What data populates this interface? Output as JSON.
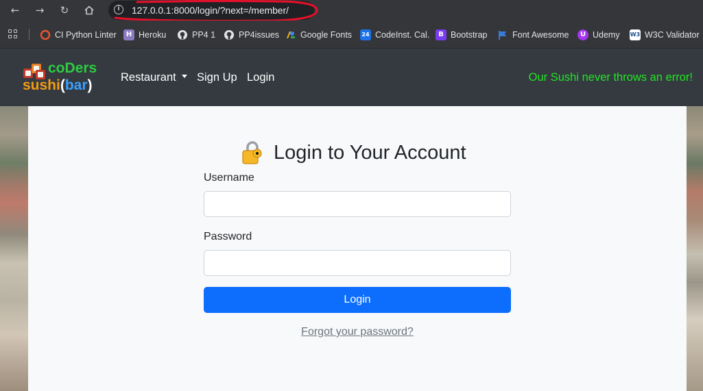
{
  "browser": {
    "url_host": "127.0.0.1",
    "url_rest": ":8000/login/?next=/member/",
    "back_icon": "arrow-left-icon",
    "forward_icon": "arrow-right-icon",
    "reload_icon": "reload-icon",
    "home_icon": "home-icon",
    "site_info_icon": "info-icon",
    "annotation_color": "#e8102a",
    "bookmarks": [
      {
        "label": "CI Python Linter",
        "icon": "ci-linter-icon",
        "color": "#e8542f"
      },
      {
        "label": "Heroku",
        "icon": "heroku-icon",
        "color": "#8c7bc0"
      },
      {
        "label": "PP4 1",
        "icon": "github-icon",
        "color": "#e3e3e3"
      },
      {
        "label": "PP4issues",
        "icon": "github-icon",
        "color": "#e3e3e3"
      },
      {
        "label": "Google Fonts",
        "icon": "google-fonts-icon",
        "color": "#4285f4"
      },
      {
        "label": "CodeInst. Cal.",
        "icon": "calendar-icon",
        "color": "#1a73e8"
      },
      {
        "label": "Bootstrap",
        "icon": "bootstrap-icon",
        "color": "#7a3cf2"
      },
      {
        "label": "Font Awesome",
        "icon": "flag-icon",
        "color": "#3a7bd5"
      },
      {
        "label": "Udemy",
        "icon": "udemy-icon",
        "color": "#a435f0"
      },
      {
        "label": "W3C Validator",
        "icon": "w3c-icon",
        "color": "#ffffff"
      }
    ]
  },
  "site": {
    "logo": {
      "top": "coDers",
      "bottom_a": "sushi",
      "bottom_b": "(",
      "bottom_c": "bar",
      "bottom_d": ")"
    },
    "nav": {
      "restaurant": "Restaurant",
      "signup": "Sign Up",
      "login": "Login"
    },
    "tagline": "Our Sushi never throws an error!",
    "tagline_color": "#22e622",
    "navbar_color": "#343a40"
  },
  "form": {
    "title": "Login to Your Account",
    "title_icon": "lock-icon",
    "username_label": "Username",
    "username_value": "",
    "password_label": "Password",
    "password_value": "",
    "submit_label": "Login",
    "submit_color": "#0d6efd",
    "forgot_link": "Forgot your password?"
  }
}
